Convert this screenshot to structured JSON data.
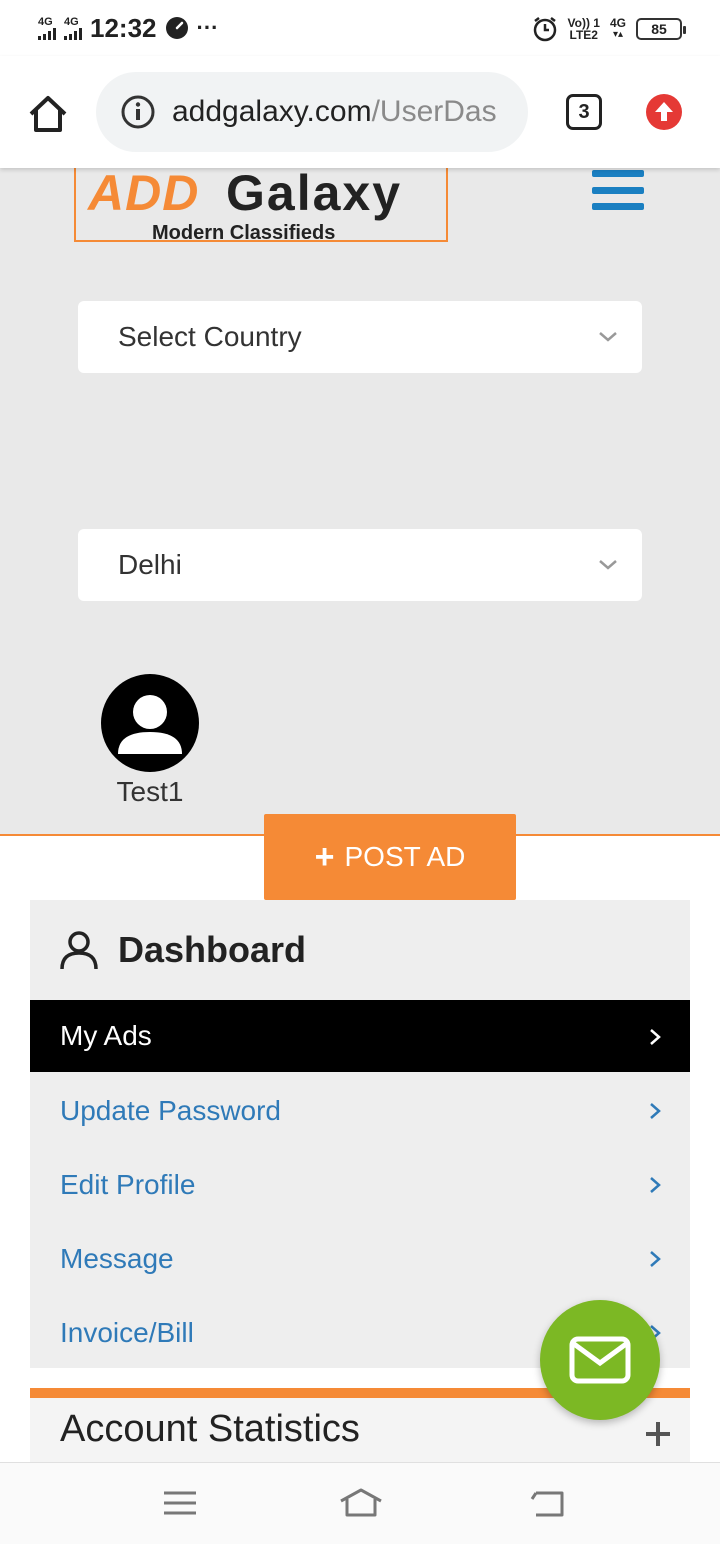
{
  "status_bar": {
    "time": "12:32",
    "signal_labels": [
      "4G",
      "4G"
    ],
    "more": "···",
    "volte": "Vo)) 1",
    "lte": "LTE2",
    "net_right": "4G",
    "battery": "85"
  },
  "browser": {
    "url_host": "addgalaxy.com",
    "url_path": "/UserDas",
    "tab_count": "3"
  },
  "logo": {
    "part1": "ADD",
    "part2": "Galaxy",
    "tagline": "Modern Classifieds"
  },
  "filters": {
    "country": "Select Country",
    "city": "Delhi"
  },
  "user": {
    "name": "Test1"
  },
  "post_ad": {
    "label": "POST AD"
  },
  "dashboard": {
    "title": "Dashboard",
    "items": [
      {
        "label": "My Ads"
      },
      {
        "label": "Update Password"
      },
      {
        "label": "Edit Profile"
      },
      {
        "label": "Message"
      },
      {
        "label": "Invoice/Bill"
      }
    ]
  },
  "account_statistics": {
    "title": "Account Statistics"
  },
  "colors": {
    "accent_orange": "#f58a36",
    "link_blue": "#2f7ab8",
    "fab_green": "#7cb824",
    "hamburger_blue": "#1a7fc1"
  }
}
